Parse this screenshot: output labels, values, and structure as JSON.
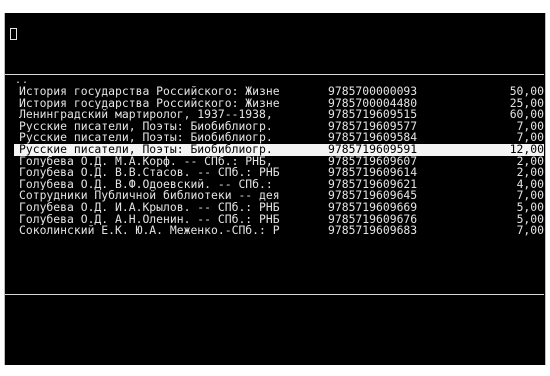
{
  "command_line": {
    "value": "",
    "cursor_glyph": "▯"
  },
  "parent_entry": "..",
  "rows": [
    {
      "title": "История государства Российского: Жизне",
      "isbn": "9785700000093",
      "price": "50,00",
      "selected": false
    },
    {
      "title": "История государства Российского: Жизне",
      "isbn": "9785700004480",
      "price": "25,00",
      "selected": false
    },
    {
      "title": "Ленинградский мартиролог, 1937--1938,",
      "isbn": "9785719609515",
      "price": "60,00",
      "selected": false
    },
    {
      "title": "Русские писатели, Поэты: Биобиблиогр.",
      "isbn": "9785719609577",
      "price": "7,00",
      "selected": false
    },
    {
      "title": "Русские писатели, Поэты: Биобиблиогр.",
      "isbn": "9785719609584",
      "price": "7,00",
      "selected": false
    },
    {
      "title": "Русские писатели, Поэты: Биобиблиогр.",
      "isbn": "9785719609591",
      "price": "12,00",
      "selected": true
    },
    {
      "title": "Голубева О.Д. М.А.Корф. -- СПб.: РНБ,",
      "isbn": "9785719609607",
      "price": "2,00",
      "selected": false
    },
    {
      "title": "Голубева О.Д. В.В.Стасов. -- СПб.: РНБ",
      "isbn": "9785719609614",
      "price": "2,00",
      "selected": false
    },
    {
      "title": "Голубева О.Д. В.Ф.Одоевский. -- СПб.:",
      "isbn": "9785719609621",
      "price": "4,00",
      "selected": false
    },
    {
      "title": "Сотрудники Публичной библиотеки -- дея",
      "isbn": "9785719609645",
      "price": "7,00",
      "selected": false
    },
    {
      "title": "Голубева О.Д. И.А.Крылов. -- СПб.: РНБ",
      "isbn": "9785719609669",
      "price": "5,00",
      "selected": false
    },
    {
      "title": "Голубева О.Д. А.Н.Оленин. -- СПб.: РНБ",
      "isbn": "9785719609676",
      "price": "5,00",
      "selected": false
    },
    {
      "title": "Соколинский Е.К. Ю.А. Меженко.-СПб.: Р",
      "isbn": "9785719609683",
      "price": "7,00",
      "selected": false
    }
  ]
}
